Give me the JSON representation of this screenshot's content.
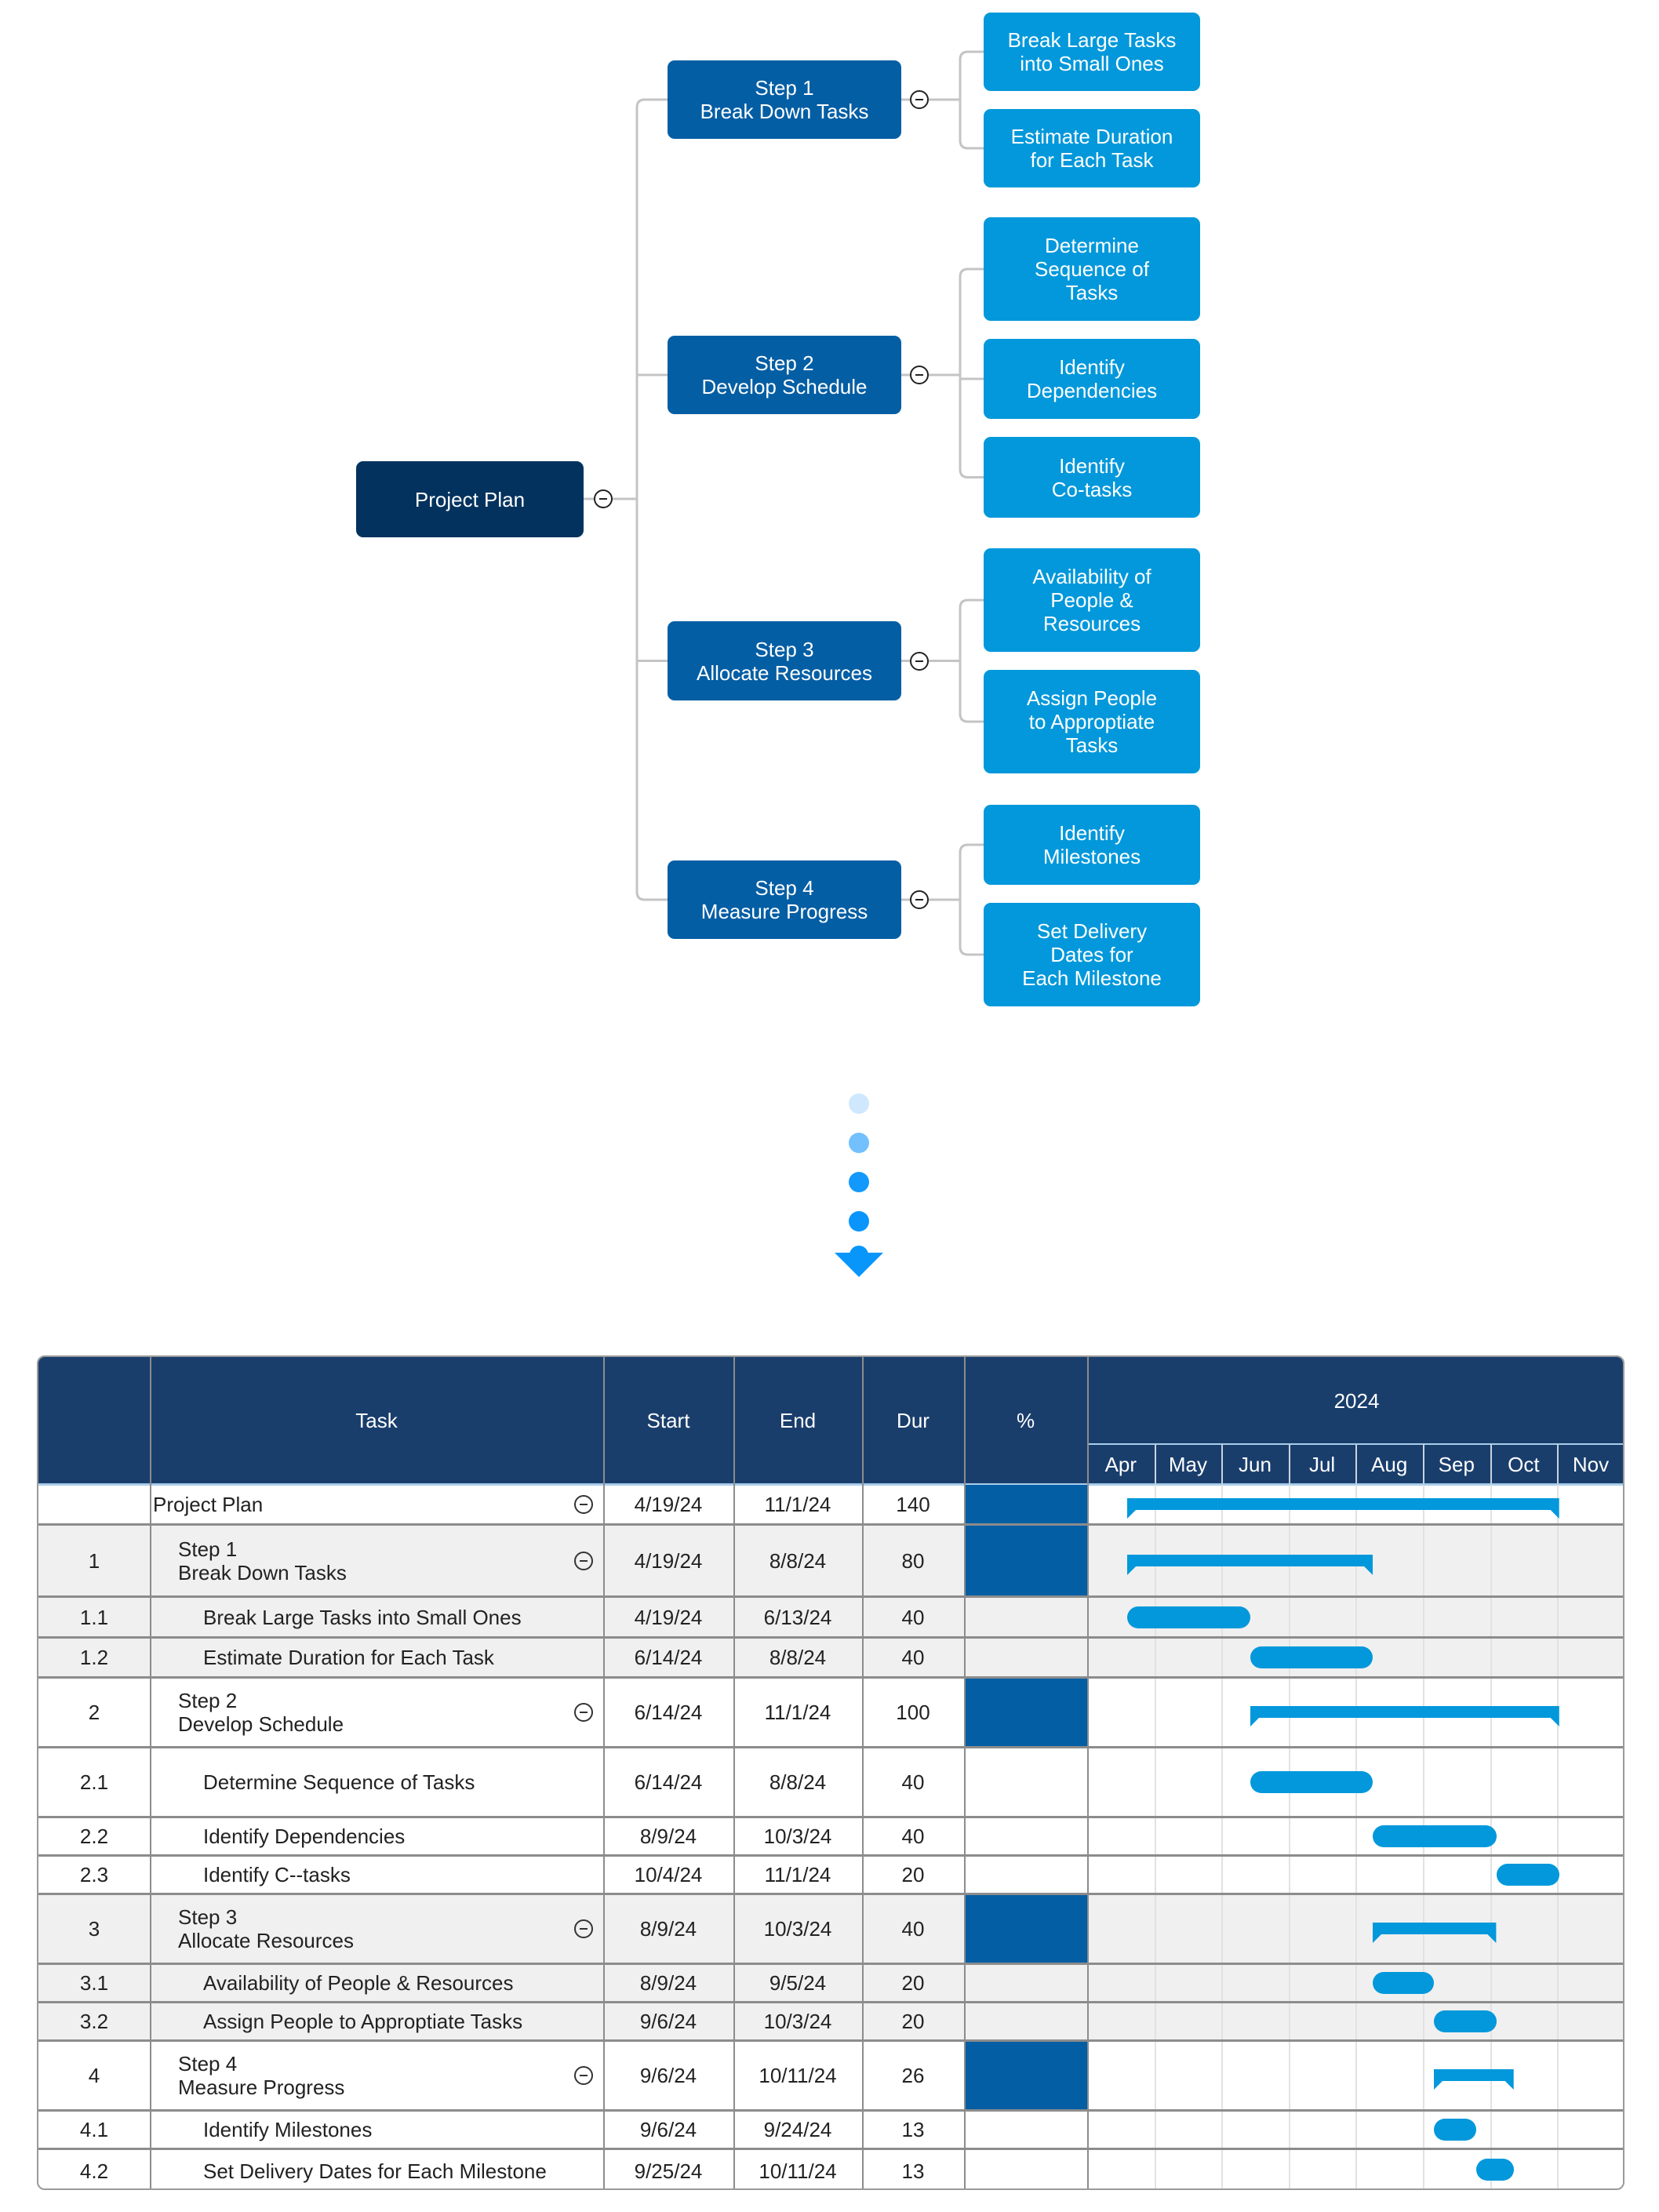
{
  "mindmap": {
    "root": {
      "label": "Project Plan"
    },
    "steps": [
      {
        "label": "Step 1\nBreak Down Tasks",
        "children": [
          "Break Large Tasks\ninto Small Ones",
          "Estimate Duration\nfor Each Task"
        ]
      },
      {
        "label": "Step 2\nDevelop Schedule",
        "children": [
          "Determine\nSequence of\nTasks",
          "Identify\nDependencies",
          "Identify\nCo-tasks"
        ]
      },
      {
        "label": "Step 3\nAllocate Resources",
        "children": [
          "Availability of\nPeople &\nResources",
          "Assign People\nto Approptiate\nTasks"
        ]
      },
      {
        "label": "Step 4\nMeasure Progress",
        "children": [
          "Identify\nMilestones",
          "Set Delivery\nDates for\nEach Milestone"
        ]
      }
    ]
  },
  "transition": {
    "icon": "down-arrow-dots-icon"
  },
  "gantt": {
    "headers": {
      "id": "",
      "task": "Task",
      "start": "Start",
      "end": "End",
      "dur": "Dur",
      "pct": "%"
    },
    "year": "2024",
    "months": [
      "Apr",
      "May",
      "Jun",
      "Jul",
      "Aug",
      "Sep",
      "Oct",
      "Nov"
    ],
    "colors": {
      "header": "#1a3e6c",
      "bar": "#0298db",
      "progress": "#045ea4"
    },
    "rows": [
      {
        "id": "",
        "task": "Project Plan",
        "level": 0,
        "summary": true,
        "start": "4/19/24",
        "end": "11/1/24",
        "dur": "140"
      },
      {
        "id": "1",
        "task": "Step 1\nBreak Down Tasks",
        "level": 1,
        "summary": true,
        "start": "4/19/24",
        "end": "8/8/24",
        "dur": "80"
      },
      {
        "id": "1.1",
        "task": "Break Large Tasks into Small Ones",
        "level": 2,
        "summary": false,
        "start": "4/19/24",
        "end": "6/13/24",
        "dur": "40"
      },
      {
        "id": "1.2",
        "task": "Estimate Duration for Each Task",
        "level": 2,
        "summary": false,
        "start": "6/14/24",
        "end": "8/8/24",
        "dur": "40"
      },
      {
        "id": "2",
        "task": "Step 2\nDevelop Schedule",
        "level": 1,
        "summary": true,
        "start": "6/14/24",
        "end": "11/1/24",
        "dur": "100"
      },
      {
        "id": "2.1",
        "task": "Determine Sequence of Tasks",
        "level": 2,
        "summary": false,
        "start": "6/14/24",
        "end": "8/8/24",
        "dur": "40"
      },
      {
        "id": "2.2",
        "task": "Identify Dependencies",
        "level": 2,
        "summary": false,
        "start": "8/9/24",
        "end": "10/3/24",
        "dur": "40"
      },
      {
        "id": "2.3",
        "task": "Identify C--tasks",
        "level": 2,
        "summary": false,
        "start": "10/4/24",
        "end": "11/1/24",
        "dur": "20"
      },
      {
        "id": "3",
        "task": "Step 3\nAllocate Resources",
        "level": 1,
        "summary": true,
        "start": "8/9/24",
        "end": "10/3/24",
        "dur": "40"
      },
      {
        "id": "3.1",
        "task": "Availability of People & Resources",
        "level": 2,
        "summary": false,
        "start": "8/9/24",
        "end": "9/5/24",
        "dur": "20"
      },
      {
        "id": "3.2",
        "task": "Assign People to Approptiate Tasks",
        "level": 2,
        "summary": false,
        "start": "9/6/24",
        "end": "10/3/24",
        "dur": "20"
      },
      {
        "id": "4",
        "task": "Step 4\nMeasure Progress",
        "level": 1,
        "summary": true,
        "start": "9/6/24",
        "end": "10/11/24",
        "dur": "26"
      },
      {
        "id": "4.1",
        "task": "Identify Milestones",
        "level": 2,
        "summary": false,
        "start": "9/6/24",
        "end": "9/24/24",
        "dur": "13"
      },
      {
        "id": "4.2",
        "task": "Set Delivery Dates for Each Milestone",
        "level": 2,
        "summary": false,
        "start": "9/25/24",
        "end": "10/11/24",
        "dur": "13"
      }
    ]
  }
}
